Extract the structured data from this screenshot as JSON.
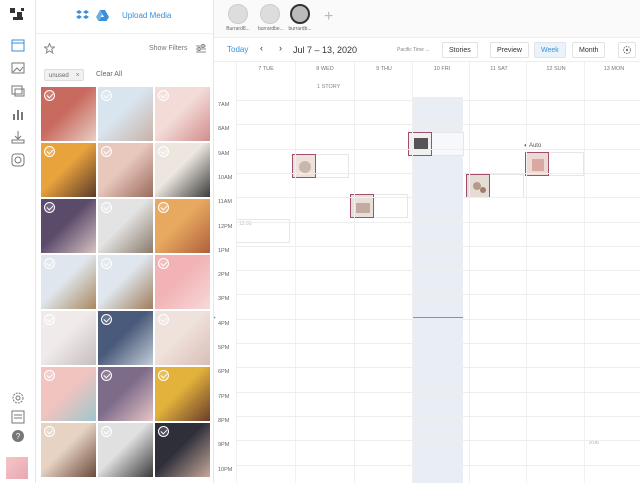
{
  "media_panel": {
    "upload_label": "Upload Media",
    "show_filters_label": "Show Filters",
    "filter_tag": "unused",
    "clear_all_label": "Clear All",
    "tiles": [
      {
        "c1": "#c96a5f",
        "c2": "#e8cfc4"
      },
      {
        "c1": "#d8e4ee",
        "c2": "#c9b2a7"
      },
      {
        "c1": "#f3dcd8",
        "c2": "#d38c8c"
      },
      {
        "c1": "#e8a33c",
        "c2": "#5a3a2a"
      },
      {
        "c1": "#e8c7bd",
        "c2": "#9a6b5c"
      },
      {
        "c1": "#ede6df",
        "c2": "#3b3b3b"
      },
      {
        "c1": "#5a4b6b",
        "c2": "#d8c2c2"
      },
      {
        "c1": "#e3e3e3",
        "c2": "#8a7a6a"
      },
      {
        "c1": "#e7a85f",
        "c2": "#b05f3c"
      },
      {
        "c1": "#dfe6ee",
        "c2": "#a8885e"
      },
      {
        "c1": "#dfe6ee",
        "c2": "#9f7d5a"
      },
      {
        "c1": "#f2b3b6",
        "c2": "#f7d9da"
      },
      {
        "c1": "#f0eaea",
        "c2": "#c7bdbd"
      },
      {
        "c1": "#4a5a7a",
        "c2": "#c3ccd8"
      },
      {
        "c1": "#efe1dc",
        "c2": "#d9bfb4"
      },
      {
        "c1": "#f2c4c0",
        "c2": "#9fc6cc"
      },
      {
        "c1": "#7d6b8a",
        "c2": "#e6c5c5"
      },
      {
        "c1": "#e2b23b",
        "c2": "#6b3b2b"
      },
      {
        "c1": "#e6d3c4",
        "c2": "#6b4a3a"
      },
      {
        "c1": "#e0e0e0",
        "c2": "#3a3a3a"
      },
      {
        "c1": "#2f2f3a",
        "c2": "#c7a99a"
      }
    ]
  },
  "accounts": [
    {
      "name": "Burrard8..."
    },
    {
      "name": "burrardbe..."
    },
    {
      "name": "burrardb..."
    }
  ],
  "nav": {
    "today": "Today",
    "range": "Jul 7 – 13, 2020",
    "timezone": "Pacific Time ...",
    "stories": "Stories",
    "preview": "Preview",
    "week": "Week",
    "month": "Month"
  },
  "calendar": {
    "days": [
      "7 TUE",
      "8 WED",
      "9 THU",
      "10 FRI",
      "11 SAT",
      "12 SUN",
      "13 MON"
    ],
    "story_count": "1 STORY",
    "hours": [
      "7AM",
      "8AM",
      "9AM",
      "10AM",
      "11AM",
      "12PM",
      "1PM",
      "2PM",
      "3PM",
      "4PM",
      "5PM",
      "6PM",
      "7PM",
      "8PM",
      "9PM",
      "10PM"
    ],
    "slot_time": "12:00",
    "auto_label": "Auto",
    "ghost_time": "9:06"
  },
  "colors": {
    "accent": "#3a8fd8",
    "post_border": "#a0506c"
  }
}
